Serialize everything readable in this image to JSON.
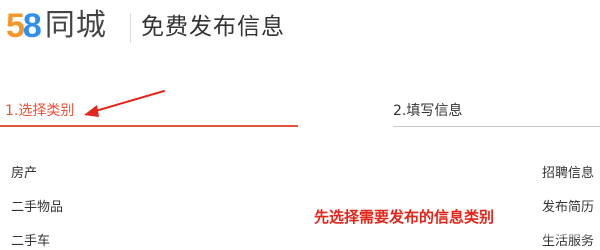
{
  "colors": {
    "accent_red": "#e8533b",
    "logo_blue": "#2e8ff0",
    "logo_orange": "#f5962b",
    "annotation_red": "#e3261b",
    "text": "#333333",
    "divider": "#c8c8c8"
  },
  "header": {
    "logo": {
      "digit_5": "5",
      "digit_8": "8",
      "word": "同城"
    },
    "title": "免费发布信息"
  },
  "steps": [
    {
      "label": "1.选择类别",
      "state": "active"
    },
    {
      "label": "2.填写信息",
      "state": "inactive"
    }
  ],
  "categories": {
    "left": [
      "房产",
      "二手物品",
      "二手车"
    ],
    "right": [
      "招聘信息",
      "发布简历",
      "生活服务"
    ]
  },
  "annotation": {
    "text": "先选择需要发布的信息类别",
    "icon": "red-arrow-icon"
  },
  "watermark": {
    "icon": "watermark-icon"
  }
}
